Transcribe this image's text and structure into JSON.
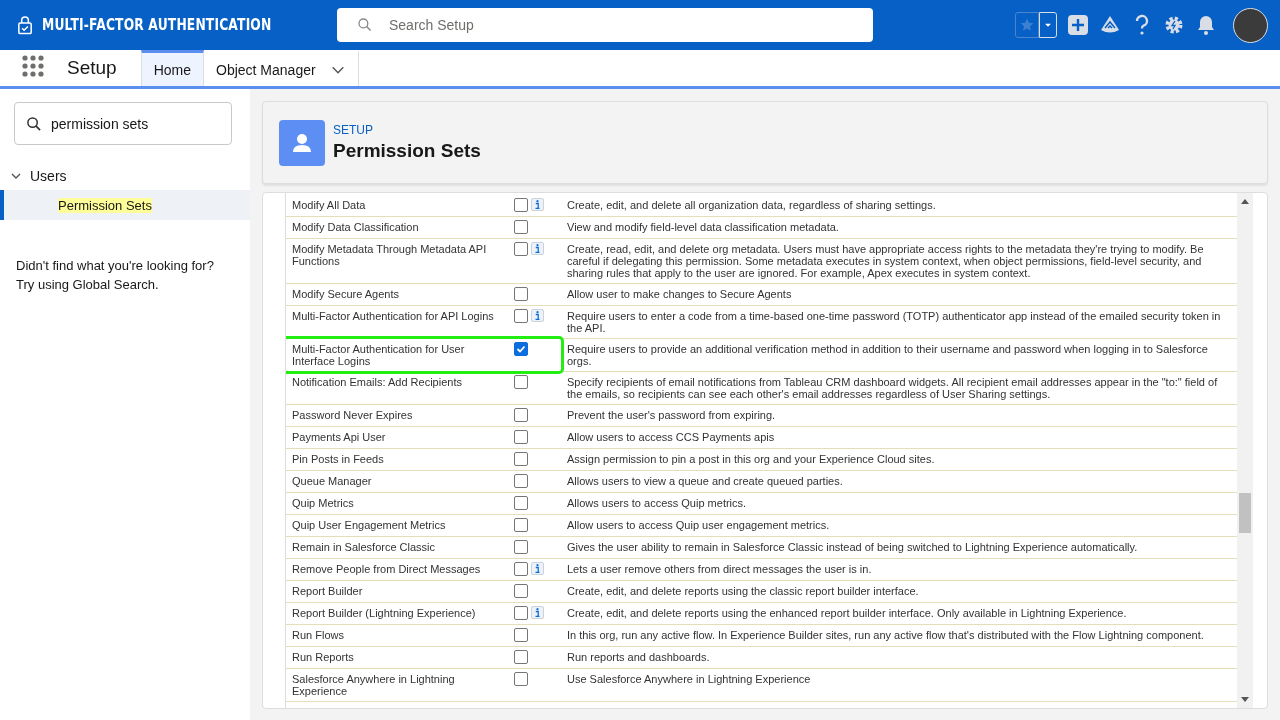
{
  "header": {
    "app_title": "MULTI-FACTOR AUTHENTICATION",
    "search": {
      "placeholder": "Search Setup"
    }
  },
  "nav": {
    "app_name": "Setup",
    "tabs": [
      {
        "label": "Home",
        "selected": true,
        "dropdown": false
      },
      {
        "label": "Object Manager",
        "selected": false,
        "dropdown": true
      }
    ]
  },
  "sidebar": {
    "search": {
      "value": "permission sets"
    },
    "tree": [
      {
        "label": "Users",
        "expanded": true,
        "selected": false,
        "children": [
          {
            "label": "Permission Sets",
            "selected": true
          }
        ]
      }
    ],
    "help": [
      "Didn't find what you're looking for?",
      "Try using Global Search."
    ]
  },
  "page_header": {
    "eyebrow": "SETUP",
    "title": "Permission Sets"
  },
  "permissions": [
    {
      "name": "Modify All Data",
      "checked": false,
      "info": true,
      "highlighted": false,
      "description": "Create, edit, and delete all organization data, regardless of sharing settings."
    },
    {
      "name": "Modify Data Classification",
      "checked": false,
      "info": false,
      "highlighted": false,
      "description": "View and modify field-level data classification metadata."
    },
    {
      "name": "Modify Metadata Through Metadata API Functions",
      "checked": false,
      "info": true,
      "highlighted": false,
      "description": "Create, read, edit, and delete org metadata. Users must have appropriate access rights to the metadata they're trying to modify. Be careful if delegating this permission. Some metadata executes in system context, when object permissions, field-level security, and sharing rules that apply to the user are ignored. For example, Apex executes in system context."
    },
    {
      "name": "Modify Secure Agents",
      "checked": false,
      "info": false,
      "highlighted": false,
      "description": "Allow user to make changes to Secure Agents"
    },
    {
      "name": "Multi-Factor Authentication for API Logins",
      "checked": false,
      "info": true,
      "highlighted": false,
      "description": "Require users to enter a code from a time-based one-time password (TOTP) authenticator app instead of the emailed security token in the API."
    },
    {
      "name": "Multi-Factor Authentication for User Interface Logins",
      "checked": true,
      "info": false,
      "highlighted": true,
      "description": "Require users to provide an additional verification method in addition to their username and password when logging in to Salesforce orgs."
    },
    {
      "name": "Notification Emails: Add Recipients",
      "checked": false,
      "info": false,
      "highlighted": false,
      "description": "Specify recipients of email notifications from Tableau CRM dashboard widgets. All recipient email addresses appear in the \"to:\" field of the emails, so recipients can see each other's email addresses regardless of User Sharing settings."
    },
    {
      "name": "Password Never Expires",
      "checked": false,
      "info": false,
      "highlighted": false,
      "description": "Prevent the user's password from expiring."
    },
    {
      "name": "Payments Api User",
      "checked": false,
      "info": false,
      "highlighted": false,
      "description": "Allow users to access CCS Payments apis"
    },
    {
      "name": "Pin Posts in Feeds",
      "checked": false,
      "info": false,
      "highlighted": false,
      "description": "Assign permission to pin a post in this org and your Experience Cloud sites."
    },
    {
      "name": "Queue Manager",
      "checked": false,
      "info": false,
      "highlighted": false,
      "description": "Allows users to view a queue and create queued parties."
    },
    {
      "name": "Quip Metrics",
      "checked": false,
      "info": false,
      "highlighted": false,
      "description": "Allows users to access Quip metrics."
    },
    {
      "name": "Quip User Engagement Metrics",
      "checked": false,
      "info": false,
      "highlighted": false,
      "description": "Allow users to access Quip user engagement metrics."
    },
    {
      "name": "Remain in Salesforce Classic",
      "checked": false,
      "info": false,
      "highlighted": false,
      "description": "Gives the user ability to remain in Salesforce Classic instead of being switched to Lightning Experience automatically."
    },
    {
      "name": "Remove People from Direct Messages",
      "checked": false,
      "info": true,
      "highlighted": false,
      "description": "Lets a user remove others from direct messages the user is in."
    },
    {
      "name": "Report Builder",
      "checked": false,
      "info": false,
      "highlighted": false,
      "description": "Create, edit, and delete reports using the classic report builder interface."
    },
    {
      "name": "Report Builder (Lightning Experience)",
      "checked": false,
      "info": true,
      "highlighted": false,
      "description": "Create, edit, and delete reports using the enhanced report builder interface. Only available in Lightning Experience."
    },
    {
      "name": "Run Flows",
      "checked": false,
      "info": false,
      "highlighted": false,
      "description": "In this org, run any active flow. In Experience Builder sites, run any active flow that's distributed with the Flow Lightning component."
    },
    {
      "name": "Run Reports",
      "checked": false,
      "info": false,
      "highlighted": false,
      "description": "Run reports and dashboards."
    },
    {
      "name": "Salesforce Anywhere in Lightning Experience",
      "checked": false,
      "info": false,
      "highlighted": false,
      "description": "Use Salesforce Anywhere in Lightning Experience"
    }
  ]
}
